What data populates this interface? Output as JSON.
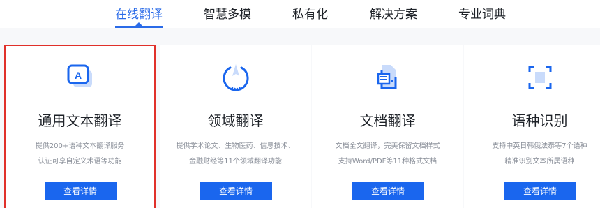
{
  "nav": {
    "items": [
      {
        "label": "在线翻译",
        "active": true
      },
      {
        "label": "智慧多模",
        "active": false
      },
      {
        "label": "私有化",
        "active": false
      },
      {
        "label": "解决方案",
        "active": false
      },
      {
        "label": "专业词典",
        "active": false
      }
    ]
  },
  "cards": [
    {
      "icon": "text-translate-icon",
      "title": "通用文本翻译",
      "desc_line1": "提供200+语种文本翻译服务",
      "desc_line2": "认证可享自定义术语等功能",
      "button": "查看详情",
      "selected": true
    },
    {
      "icon": "domain-translate-icon",
      "title": "领域翻译",
      "desc_line1": "提供学术论文、生物医药、信息技术、",
      "desc_line2": "金融财经等11个领域翻译功能",
      "button": "查看详情",
      "selected": false
    },
    {
      "icon": "document-translate-icon",
      "title": "文档翻译",
      "desc_line1": "文档全文翻译，完美保留文档样式",
      "desc_line2": "支持Word/PDF等11种格式文档",
      "button": "查看详情",
      "selected": false
    },
    {
      "icon": "language-detect-icon",
      "title": "语种识别",
      "desc_line1": "支持中英日韩俄法泰等7个语种",
      "desc_line2": "精准识别文本所属语种",
      "button": "查看详情",
      "selected": false
    }
  ],
  "colors": {
    "accent": "#2a6be8",
    "button": "#1a66ee",
    "selection_border": "#e0302a",
    "page_bg": "#f7f8fa"
  }
}
